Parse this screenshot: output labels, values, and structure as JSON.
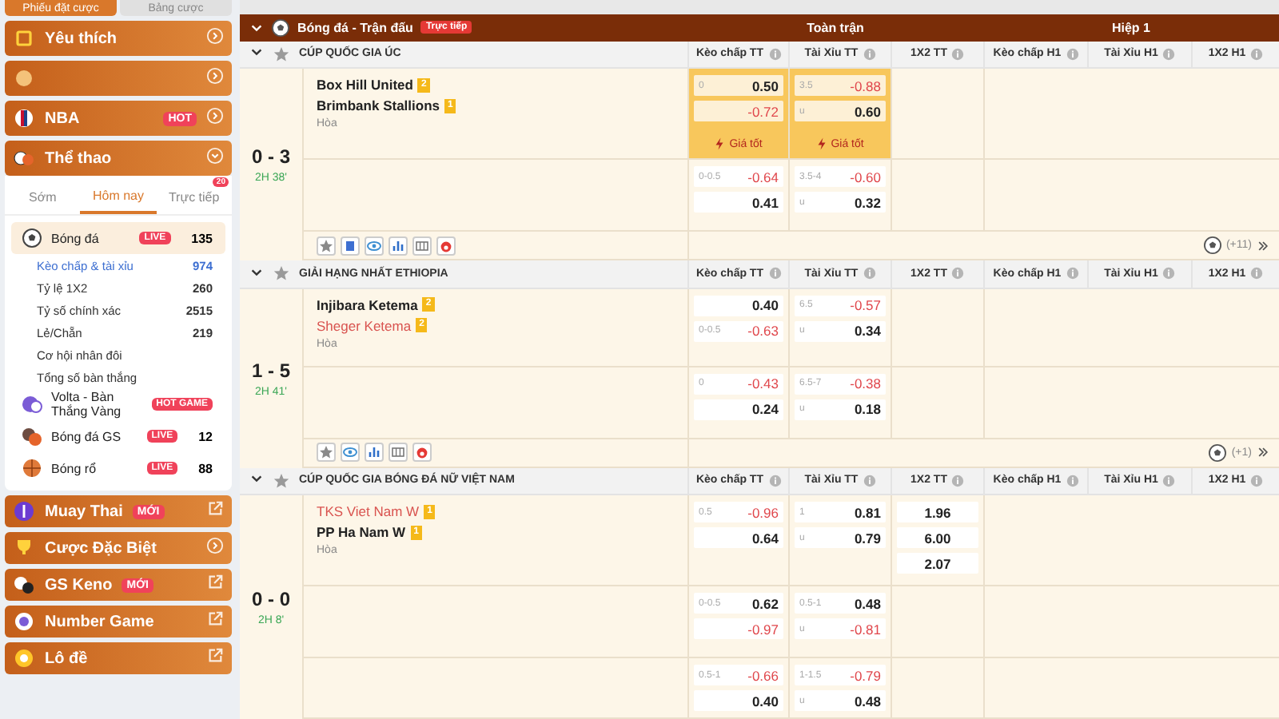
{
  "sidebar": {
    "top_tabs": [
      {
        "label": "Phiếu đặt cược",
        "selected": true
      },
      {
        "label": "Bảng cược",
        "selected": false
      }
    ],
    "menu": [
      {
        "label": "Yêu thích",
        "expanded": false
      },
      {
        "expanded": false
      },
      {
        "label": "NBA",
        "badge": "HOT",
        "expanded": false
      },
      {
        "label": "Thể thao",
        "expanded": true
      }
    ],
    "sport_tabs": [
      {
        "label": "Sớm",
        "selected": false
      },
      {
        "label": "Hôm nay",
        "selected": true
      },
      {
        "label": "Trực tiếp",
        "selected": false,
        "badge": "20"
      }
    ],
    "sports": [
      {
        "name": "Bóng đá",
        "badge": "LIVE",
        "count": "135",
        "selected": true,
        "children": [
          {
            "label": "Kèo chấp & tài xỉu",
            "count": "974",
            "selected": true
          },
          {
            "label": "Tỷ lệ 1X2",
            "count": "260",
            "selected": false
          },
          {
            "label": "Tỷ số chính xác",
            "count": "2515",
            "selected": false
          },
          {
            "label": "Lẻ/Chẵn",
            "count": "219",
            "selected": false
          },
          {
            "label": "Cơ hội nhân đôi",
            "selected": false
          },
          {
            "label": "Tổng số bàn thắng",
            "selected": false
          }
        ]
      },
      {
        "name": "Volta - Bàn Thắng Vàng",
        "badge": "HOT GAME",
        "selected": false
      },
      {
        "name": "Bóng đá GS",
        "badge": "LIVE",
        "count": "12",
        "selected": false
      },
      {
        "name": "Bóng rổ",
        "badge": "LIVE",
        "count": "88",
        "selected": false
      }
    ],
    "bottom_menu": [
      {
        "label": "Muay Thai",
        "badge": "MỚI",
        "external": true
      },
      {
        "label": "Cược Đặc Biệt",
        "external": false
      },
      {
        "label": "GS Keno",
        "badge": "MỚI",
        "external": true
      },
      {
        "label": "Number Game",
        "external": true
      },
      {
        "label": "Lô đề",
        "external": true
      }
    ]
  },
  "main": {
    "header": {
      "title": "Bóng đá - Trận đấu",
      "badge": "Trực tiếp",
      "groups": [
        "Toàn trận",
        "Hiệp 1"
      ]
    },
    "leagues": [
      {
        "name": "CÚP QUỐC GIA ÚC",
        "expanded": true,
        "columns": [
          "Kèo chấp TT",
          "Tài Xỉu TT",
          "1X2 TT",
          "Kèo chấp H1",
          "Tài Xỉu H1",
          "1X2 H1"
        ],
        "match": {
          "score": "0 - 3",
          "time": "2H 38'",
          "teams": [
            {
              "name": "Box Hill United",
              "cards": "2",
              "highlighted": false
            },
            {
              "name": "Brimbank Stallions",
              "cards": "1",
              "highlighted": false
            }
          ],
          "draw": "Hòa",
          "rows": [
            {
              "cells": [
                {
                  "best": "Giá tốt",
                  "lines": [
                    {
                      "label": "0",
                      "value": "0.50",
                      "red": false
                    },
                    {
                      "value": "-0.72",
                      "red": true
                    }
                  ]
                },
                {
                  "best": "Giá tốt",
                  "lines": [
                    {
                      "label": "3.5",
                      "value": "-0.88",
                      "red": true
                    },
                    {
                      "label": "u",
                      "value": "0.60",
                      "red": false
                    }
                  ]
                },
                null
              ]
            },
            {
              "cells": [
                {
                  "lines": [
                    {
                      "label": "0-0.5",
                      "value": "-0.64",
                      "red": true
                    },
                    {
                      "value": "0.41",
                      "red": false
                    }
                  ]
                },
                {
                  "lines": [
                    {
                      "label": "3.5-4",
                      "value": "-0.60",
                      "red": true
                    },
                    {
                      "label": "u",
                      "value": "0.32",
                      "red": false
                    }
                  ]
                },
                null
              ]
            }
          ],
          "team_info": true,
          "more": "(+11)"
        }
      },
      {
        "name": "GIẢI HẠNG NHẤT ETHIOPIA",
        "expanded": true,
        "columns": [
          "Kèo chấp TT",
          "Tài Xỉu TT",
          "1X2 TT",
          "Kèo chấp H1",
          "Tài Xỉu H1",
          "1X2 H1"
        ],
        "match": {
          "score": "1 - 5",
          "time": "2H 41'",
          "teams": [
            {
              "name": "Injibara Ketema",
              "cards": "2",
              "highlighted": false
            },
            {
              "name": "Sheger Ketema",
              "cards": "2",
              "highlighted": true
            }
          ],
          "draw": "Hòa",
          "rows": [
            {
              "cells": [
                {
                  "lines": [
                    {
                      "value": "0.40",
                      "red": false
                    },
                    {
                      "label": "0-0.5",
                      "value": "-0.63",
                      "red": true
                    }
                  ]
                },
                {
                  "lines": [
                    {
                      "label": "6.5",
                      "value": "-0.57",
                      "red": true
                    },
                    {
                      "label": "u",
                      "value": "0.34",
                      "red": false
                    }
                  ]
                },
                null
              ]
            },
            {
              "cells": [
                {
                  "lines": [
                    {
                      "label": "0",
                      "value": "-0.43",
                      "red": true
                    },
                    {
                      "value": "0.24",
                      "red": false
                    }
                  ]
                },
                {
                  "lines": [
                    {
                      "label": "6.5-7",
                      "value": "-0.38",
                      "red": true
                    },
                    {
                      "label": "u",
                      "value": "0.18",
                      "red": false
                    }
                  ]
                },
                null
              ]
            }
          ],
          "team_info": false,
          "more": "(+1)"
        }
      },
      {
        "name": "CÚP QUỐC GIA BÓNG ĐÁ NỮ VIỆT NAM",
        "expanded": true,
        "columns": [
          "Kèo chấp TT",
          "Tài Xỉu TT",
          "1X2 TT",
          "Kèo chấp H1",
          "Tài Xỉu H1",
          "1X2 H1"
        ],
        "match": {
          "score": "0 - 0",
          "time": "2H 8'",
          "teams": [
            {
              "name": "TKS Viet Nam W",
              "cards": "1",
              "highlighted": true
            },
            {
              "name": "PP Ha Nam W",
              "cards": "1",
              "highlighted": false
            }
          ],
          "draw": "Hòa",
          "rows": [
            {
              "cells": [
                {
                  "lines": [
                    {
                      "label": "0.5",
                      "value": "-0.96",
                      "red": true
                    },
                    {
                      "value": "0.64",
                      "red": false
                    }
                  ]
                },
                {
                  "lines": [
                    {
                      "label": "1",
                      "value": "0.81",
                      "red": false
                    },
                    {
                      "label": "u",
                      "value": "0.79",
                      "red": false
                    }
                  ]
                },
                {
                  "lines": [
                    {
                      "value": "1.96",
                      "red": false
                    },
                    {
                      "value": "6.00",
                      "red": false
                    },
                    {
                      "value": "2.07",
                      "red": false
                    }
                  ]
                }
              ]
            },
            {
              "cells": [
                {
                  "lines": [
                    {
                      "label": "0-0.5",
                      "value": "0.62",
                      "red": false
                    },
                    {
                      "value": "-0.97",
                      "red": true
                    }
                  ]
                },
                {
                  "lines": [
                    {
                      "label": "0.5-1",
                      "value": "0.48",
                      "red": false
                    },
                    {
                      "label": "u",
                      "value": "-0.81",
                      "red": true
                    }
                  ]
                },
                null
              ]
            },
            {
              "cells": [
                {
                  "lines": [
                    {
                      "label": "0.5-1",
                      "value": "-0.66",
                      "red": true
                    },
                    {
                      "value": "0.40",
                      "red": false
                    }
                  ]
                },
                {
                  "lines": [
                    {
                      "label": "1-1.5",
                      "value": "-0.79",
                      "red": true
                    },
                    {
                      "label": "u",
                      "value": "0.48",
                      "red": false
                    }
                  ]
                },
                null
              ]
            }
          ]
        }
      }
    ]
  }
}
